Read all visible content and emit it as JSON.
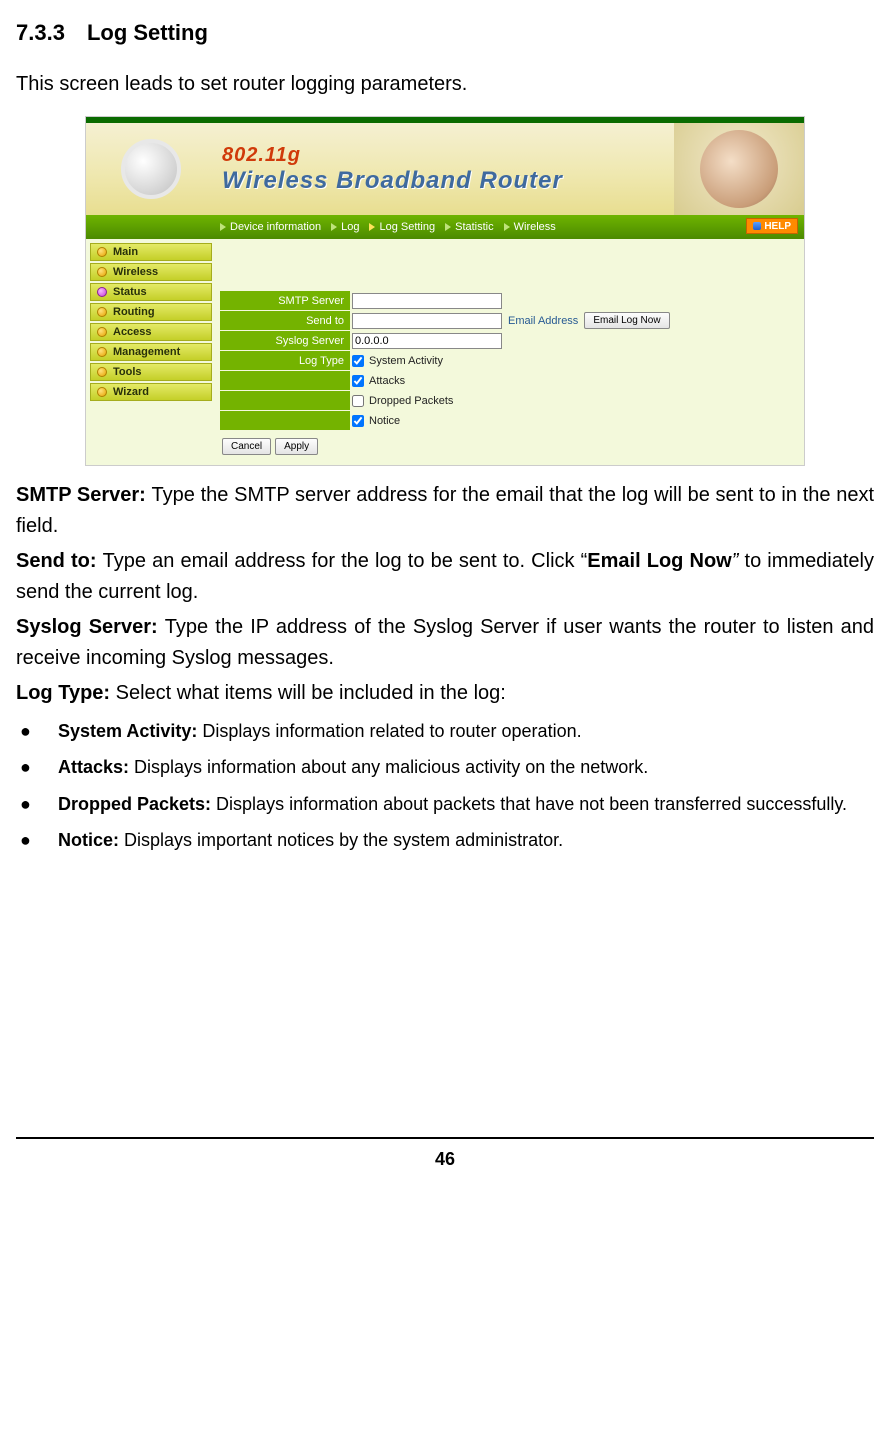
{
  "heading": {
    "number": "7.3.3",
    "title": "Log Setting"
  },
  "intro": "This screen leads to set router logging parameters.",
  "shot": {
    "header": {
      "line1": "802.11g",
      "line2": "Wireless Broadband Router"
    },
    "nav": {
      "items": [
        "Device information",
        "Log",
        "Log Setting",
        "Statistic",
        "Wireless"
      ],
      "help": "HELP"
    },
    "sidebar": [
      "Main",
      "Wireless",
      "Status",
      "Routing",
      "Access",
      "Management",
      "Tools",
      "Wizard"
    ],
    "form": {
      "smtp_label": "SMTP Server",
      "smtp_value": "",
      "sendto_label": "Send to",
      "sendto_value": "",
      "email_address_label": "Email Address",
      "email_log_now_btn": "Email Log Now",
      "syslog_label": "Syslog Server",
      "syslog_value": "0.0.0.0",
      "logtype_label": "Log Type",
      "logtype_opts": {
        "system_activity": "System Activity",
        "attacks": "Attacks",
        "dropped_packets": "Dropped Packets",
        "notice": "Notice"
      },
      "cancel_btn": "Cancel",
      "apply_btn": "Apply"
    }
  },
  "manual": {
    "p1_a": "SMTP Server: ",
    "p1_b": "Type the SMTP server address for the email that the log will be sent to in the next field.",
    "p2_a": "Send to: ",
    "p2_b": "Type an email address for the log to be sent to. Click “",
    "p2_c": "Email Log Now",
    "p2_d": "”",
    "p2_e": " to immediately send the current log.",
    "p3_a": "Syslog Server: ",
    "p3_b": "Type the IP address of the Syslog Server if user wants the router to listen and receive incoming Syslog messages.",
    "p4_a": "Log Type: ",
    "p4_b": "Select what items will be included in the log:",
    "bullets": [
      {
        "label": "System Activity: ",
        "text": "Displays information related to router operation."
      },
      {
        "label": "Attacks: ",
        "text": "Displays information about any malicious activity on the network."
      },
      {
        "label": "Dropped Packets: ",
        "text": "Displays information about packets that have not been transferred successfully."
      },
      {
        "label": "Notice: ",
        "text": "Displays important notices by the system administrator."
      }
    ]
  },
  "page_number": "46"
}
